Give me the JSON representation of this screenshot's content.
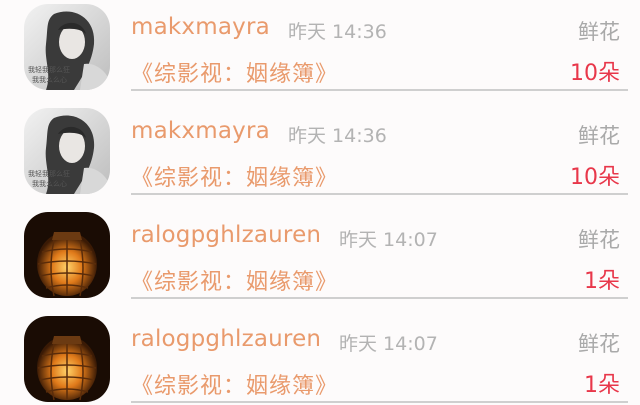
{
  "items": [
    {
      "avatar": "avatar-girl-bw",
      "username": "makxmayra",
      "time": "昨天 14:36",
      "gift_label": "鲜花",
      "work": "《综影视：姻缘簿》",
      "count": "10朵",
      "avatar_caption_1": "我轻我那么狂",
      "avatar_caption_2": "我我么么心"
    },
    {
      "avatar": "avatar-girl-bw",
      "username": "makxmayra",
      "time": "昨天 14:36",
      "gift_label": "鲜花",
      "work": "《综影视：姻缘簿》",
      "count": "10朵",
      "avatar_caption_1": "我轻我那么狂",
      "avatar_caption_2": "我我么么心"
    },
    {
      "avatar": "avatar-lantern",
      "username": "ralogpghlzauren",
      "time": "昨天 14:07",
      "gift_label": "鲜花",
      "work": "《综影视：姻缘簿》",
      "count": "1朵"
    },
    {
      "avatar": "avatar-lantern",
      "username": "ralogpghlzauren",
      "time": "昨天 14:07",
      "gift_label": "鲜花",
      "work": "《综影视：姻缘簿》",
      "count": "1朵"
    }
  ],
  "colors": {
    "username": "#e99a6c",
    "time": "#b3b3b3",
    "gift_label": "#a9a9a9",
    "count": "#e8374a",
    "divider": "#cfcfcf"
  }
}
